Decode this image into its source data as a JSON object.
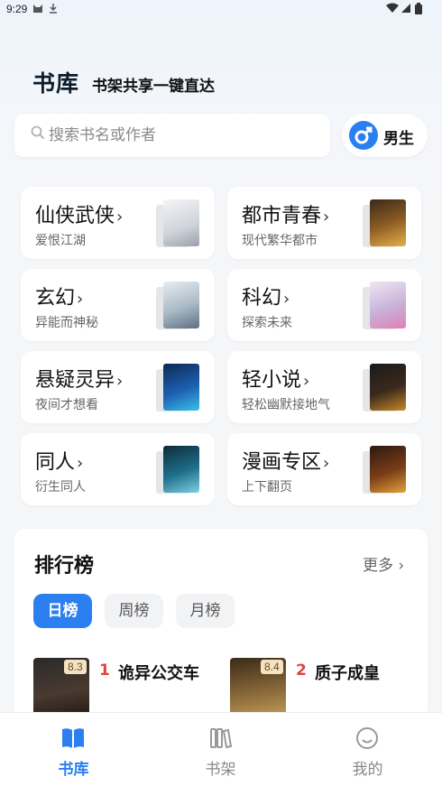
{
  "status_bar": {
    "time": "9:29"
  },
  "header": {
    "title": "书库",
    "subtitle": "书架共享一键直达"
  },
  "search": {
    "placeholder": "搜索书名或作者"
  },
  "gender": {
    "label": "男生",
    "icon": "male-icon"
  },
  "categories": [
    {
      "title": "仙侠武侠",
      "subtitle": "爱恨江湖"
    },
    {
      "title": "都市青春",
      "subtitle": "现代繁华都市"
    },
    {
      "title": "玄幻",
      "subtitle": "异能而神秘"
    },
    {
      "title": "科幻",
      "subtitle": "探索未来"
    },
    {
      "title": "悬疑灵异",
      "subtitle": "夜间才想看"
    },
    {
      "title": "轻小说",
      "subtitle": "轻松幽默接地气"
    },
    {
      "title": "同人",
      "subtitle": "衍生同人"
    },
    {
      "title": "漫画专区",
      "subtitle": "上下翻页"
    }
  ],
  "ranking": {
    "title": "排行榜",
    "more": "更多",
    "tabs": [
      "日榜",
      "周榜",
      "月榜"
    ],
    "active_tab": "日榜",
    "books": [
      {
        "rank": "1",
        "name": "诡异公交车",
        "score": "8.3"
      },
      {
        "rank": "2",
        "name": "质子成皇",
        "score": "8.4"
      }
    ]
  },
  "nav": {
    "items": [
      {
        "label": "书库",
        "icon": "book-open-icon"
      },
      {
        "label": "书架",
        "icon": "bookshelf-icon"
      },
      {
        "label": "我的",
        "icon": "smile-icon"
      }
    ],
    "active": "书库"
  },
  "colors": {
    "accent": "#2b7ff0",
    "rank_number": "#e0443b"
  }
}
